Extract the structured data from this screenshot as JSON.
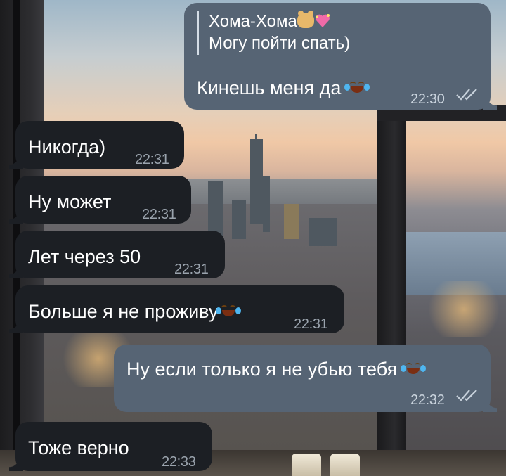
{
  "messages": [
    {
      "direction": "out",
      "reply": {
        "name": "Хома-Хома",
        "text": "Могу пойти спать)"
      },
      "text": "Кинешь меня да",
      "emoji": "laughing-crying-icon",
      "time": "22:30",
      "status": "read"
    },
    {
      "direction": "in",
      "text": "Никогда)",
      "time": "22:31"
    },
    {
      "direction": "in",
      "text": "Ну может",
      "time": "22:31"
    },
    {
      "direction": "in",
      "text": "Лет через 50",
      "time": "22:31"
    },
    {
      "direction": "in",
      "text": "Больше я не проживу",
      "emoji": "laughing-crying-icon",
      "time": "22:31"
    },
    {
      "direction": "out",
      "text": "Ну если только я не убью тебя",
      "emoji": "laughing-crying-icon",
      "time": "22:32",
      "status": "read"
    },
    {
      "direction": "in",
      "text": "Тоже верно",
      "time": "22:33"
    }
  ],
  "colors": {
    "incoming_bubble": "#1c1f24",
    "outgoing_bubble": "#566474",
    "text": "#ffffff"
  }
}
